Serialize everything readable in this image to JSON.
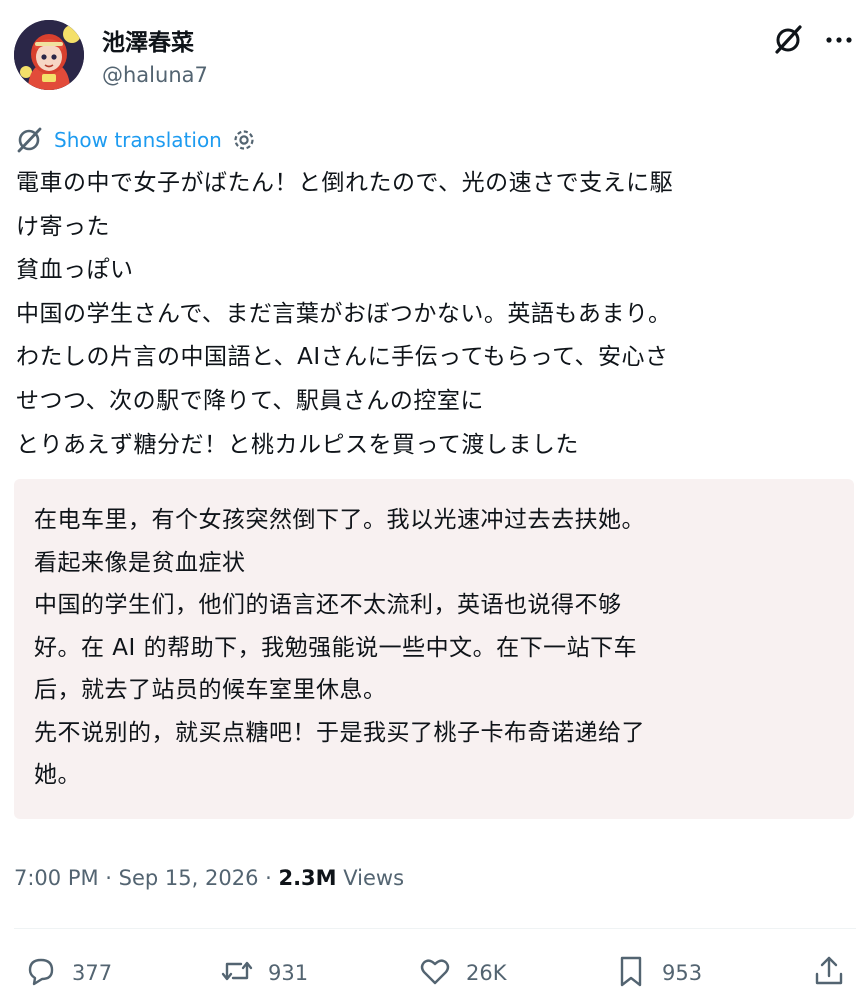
{
  "author": {
    "name": "池澤春菜",
    "handle": "@haluna7"
  },
  "translate": {
    "show_label": "Show translation"
  },
  "tweet": {
    "text": "電車の中で女子がばたん！と倒れたので、光の速さで支えに駆\nけ寄った\n貧血っぽい\n中国の学生さんで、まだ言葉がおぼつかない。英語もあまり。\nわたしの片言の中国語と、AIさんに手伝ってもらって、安心さ\nせつつ、次の駅で降りて、駅員さんの控室に\nとりあえず糖分だ！と桃カルピスを買って渡しました"
  },
  "translation": {
    "text": "在电车里，有个女孩突然倒下了。我以光速冲过去去扶她。\n看起来像是贫血症状\n中国的学生们，他们的语言还不太流利，英语也说得不够\n好。在 AI 的帮助下，我勉强能说一些中文。在下一站下车\n后，就去了站员的候车室里休息。\n先不说别的，就买点糖吧！于是我买了桃子卡布奇诺递给了\n她。"
  },
  "meta": {
    "time": "7:00 PM",
    "separator": " · ",
    "date": "Sep 15, 2026",
    "views_count": "2.3M",
    "views_label": " Views"
  },
  "actions": {
    "replies": "377",
    "reposts": "931",
    "likes": "26K",
    "bookmarks": "953"
  },
  "icons": {
    "grok": "grok-icon",
    "more": "more-dots-icon",
    "settings": "gear-icon",
    "reply": "reply-bubble-icon",
    "repost": "repost-arrows-icon",
    "like": "heart-icon",
    "bookmark": "bookmark-icon",
    "share": "share-upload-icon"
  },
  "colors": {
    "accent": "#1d9bf0",
    "text": "#0f1419",
    "muted": "#536471",
    "translation_bg": "#f8f1f1"
  }
}
